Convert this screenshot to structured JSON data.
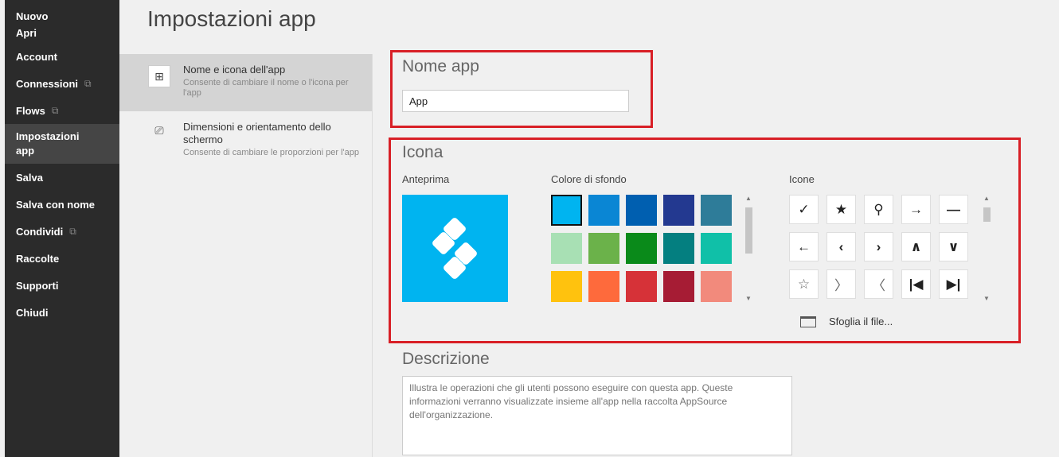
{
  "sidebar": {
    "items": [
      {
        "label": "Nuovo",
        "external": false
      },
      {
        "label": "Apri",
        "external": false
      },
      {
        "label": "Account",
        "external": false
      },
      {
        "label": "Connessioni",
        "external": true
      },
      {
        "label": "Flows",
        "external": true
      },
      {
        "label": "Impostazioni app",
        "external": false,
        "active": true
      },
      {
        "label": "Salva",
        "external": false
      },
      {
        "label": "Salva con nome",
        "external": false
      },
      {
        "label": "Condividi",
        "external": true
      },
      {
        "label": "Raccolte",
        "external": false
      },
      {
        "label": "Supporti",
        "external": false
      },
      {
        "label": "Chiudi",
        "external": false
      }
    ]
  },
  "page": {
    "title": "Impostazioni app"
  },
  "subnav": {
    "items": [
      {
        "title": "Nome e icona dell'app",
        "description": "Consente di cambiare il nome o l'icona per l'app",
        "icon": "grid-icon"
      },
      {
        "title": "Dimensioni e orientamento dello schermo",
        "description": "Consente di cambiare le proporzioni per l'app",
        "icon": "devices-icon"
      }
    ]
  },
  "app_name": {
    "heading": "Nome app",
    "value": "App"
  },
  "icon_section": {
    "heading": "Icona",
    "preview_label": "Anteprima",
    "preview_color": "#00b4f0",
    "bg_label": "Colore di sfondo",
    "icons_label": "Icone",
    "colors": [
      "#00b4f0",
      "#0a86d4",
      "#005fb0",
      "#233990",
      "#2e7c99",
      "#a8e0b4",
      "#6bb24a",
      "#0a8a1a",
      "#047f80",
      "#10c0a8",
      "#ffc20e",
      "#fe6a3c",
      "#d63238",
      "#a61c34",
      "#f28a7c"
    ],
    "icons": [
      "✓",
      "★",
      "⚲",
      "→",
      "—",
      "←",
      "‹",
      "›",
      "∧",
      "∨",
      "☆",
      "〉",
      "〈",
      "|◀",
      "▶|"
    ],
    "browse_label": "Sfoglia il file..."
  },
  "description": {
    "heading": "Descrizione",
    "placeholder": "Illustra le operazioni che gli utenti possono eseguire con questa app. Queste informazioni verranno visualizzate insieme all'app nella raccolta AppSource dell'organizzazione."
  },
  "accent_color": "#d81f26"
}
